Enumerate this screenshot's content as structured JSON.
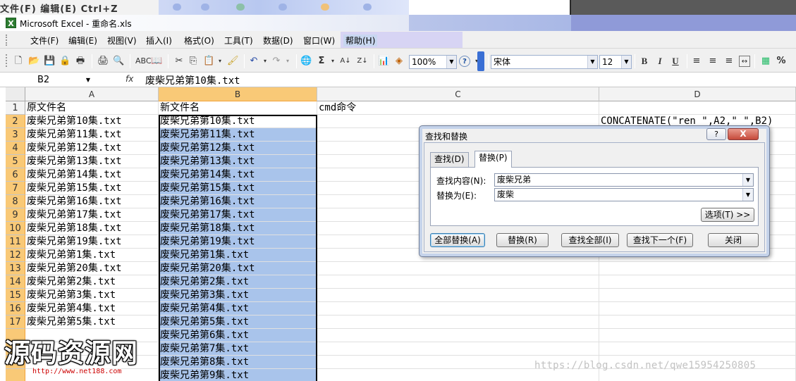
{
  "background": {
    "left_fragment": "文件(F) 编辑(E) Ctrl+Z"
  },
  "window": {
    "title": "Microsoft Excel - 重命名.xls",
    "app_icon_letter": "X"
  },
  "menu": [
    {
      "label": "文件(F)"
    },
    {
      "label": "编辑(E)"
    },
    {
      "label": "视图(V)"
    },
    {
      "label": "插入(I)"
    },
    {
      "label": "格式(O)"
    },
    {
      "label": "工具(T)"
    },
    {
      "label": "数据(D)"
    },
    {
      "label": "窗口(W)"
    },
    {
      "label": "帮助(H)"
    }
  ],
  "toolbar": {
    "zoom": "100%",
    "font": "宋体",
    "font_size": "12",
    "bold": "B",
    "italic": "I",
    "underline": "U",
    "percent": "%",
    "sum": "Σ",
    "help": "?"
  },
  "formula_bar": {
    "name_box": "B2",
    "fx": "fx",
    "content": "废柴兄弟第10集.txt"
  },
  "grid": {
    "columns": [
      {
        "label": "A"
      },
      {
        "label": "B"
      },
      {
        "label": "C"
      },
      {
        "label": "D"
      }
    ],
    "rows": [
      {
        "num": "1",
        "a": "原文件名",
        "b": "新文件名",
        "c": "cmd命令",
        "d": ""
      },
      {
        "num": "2",
        "a": "废柴兄弟第10集.txt",
        "b": "废柴兄弟第10集.txt",
        "c": "",
        "d": "CONCATENATE(\"ren \",A2,\" \",B2)"
      },
      {
        "num": "3",
        "a": "废柴兄弟第11集.txt",
        "b": "废柴兄弟第11集.txt",
        "c": "",
        "d": ""
      },
      {
        "num": "4",
        "a": "废柴兄弟第12集.txt",
        "b": "废柴兄弟第12集.txt",
        "c": "",
        "d": ""
      },
      {
        "num": "5",
        "a": "废柴兄弟第13集.txt",
        "b": "废柴兄弟第13集.txt",
        "c": "",
        "d": ""
      },
      {
        "num": "6",
        "a": "废柴兄弟第14集.txt",
        "b": "废柴兄弟第14集.txt",
        "c": "",
        "d": ""
      },
      {
        "num": "7",
        "a": "废柴兄弟第15集.txt",
        "b": "废柴兄弟第15集.txt",
        "c": "",
        "d": ""
      },
      {
        "num": "8",
        "a": "废柴兄弟第16集.txt",
        "b": "废柴兄弟第16集.txt",
        "c": "",
        "d": ""
      },
      {
        "num": "9",
        "a": "废柴兄弟第17集.txt",
        "b": "废柴兄弟第17集.txt",
        "c": "",
        "d": ""
      },
      {
        "num": "10",
        "a": "废柴兄弟第18集.txt",
        "b": "废柴兄弟第18集.txt",
        "c": "",
        "d": ""
      },
      {
        "num": "11",
        "a": "废柴兄弟第19集.txt",
        "b": "废柴兄弟第19集.txt",
        "c": "",
        "d": ""
      },
      {
        "num": "12",
        "a": "废柴兄弟第1集.txt",
        "b": "废柴兄弟第1集.txt",
        "c": "",
        "d": ""
      },
      {
        "num": "13",
        "a": "废柴兄弟第20集.txt",
        "b": "废柴兄弟第20集.txt",
        "c": "",
        "d": ""
      },
      {
        "num": "14",
        "a": "废柴兄弟第2集.txt",
        "b": "废柴兄弟第2集.txt",
        "c": "",
        "d": ""
      },
      {
        "num": "15",
        "a": "废柴兄弟第3集.txt",
        "b": "废柴兄弟第3集.txt",
        "c": "",
        "d": ""
      },
      {
        "num": "16",
        "a": "废柴兄弟第4集.txt",
        "b": "废柴兄弟第4集.txt",
        "c": "",
        "d": ""
      },
      {
        "num": "17",
        "a": "废柴兄弟第5集.txt",
        "b": "废柴兄弟第5集.txt",
        "c": "",
        "d": ""
      },
      {
        "num": "",
        "a": "",
        "b": "废柴兄弟第6集.txt",
        "c": "",
        "d": ""
      },
      {
        "num": "",
        "a": "",
        "b": "废柴兄弟第7集.txt",
        "c": "",
        "d": ""
      },
      {
        "num": "",
        "a": "",
        "b": "废柴兄弟第8集.txt",
        "c": "",
        "d": ""
      },
      {
        "num": "",
        "a": "",
        "b": "废柴兄弟第9集.txt",
        "c": "",
        "d": ""
      }
    ]
  },
  "dialog": {
    "title": "查找和替换",
    "help": "?",
    "close": "X",
    "tabs": [
      {
        "label": "查找(D)"
      },
      {
        "label": "替换(P)"
      }
    ],
    "find_label": "查找内容(N):",
    "find_value": "废柴兄弟",
    "replace_label": "替换为(E):",
    "replace_value": "废柴",
    "options_button": "选项(T) >>",
    "buttons": {
      "replace_all": "全部替换(A)",
      "replace": "替换(R)",
      "find_all": "查找全部(I)",
      "find_next": "查找下一个(F)",
      "close": "关闭"
    }
  },
  "watermarks": {
    "logo": "源码资源网",
    "logo_url": "http://www.net188.com",
    "csdn": "https://blog.csdn.net/qwe15954250805"
  }
}
